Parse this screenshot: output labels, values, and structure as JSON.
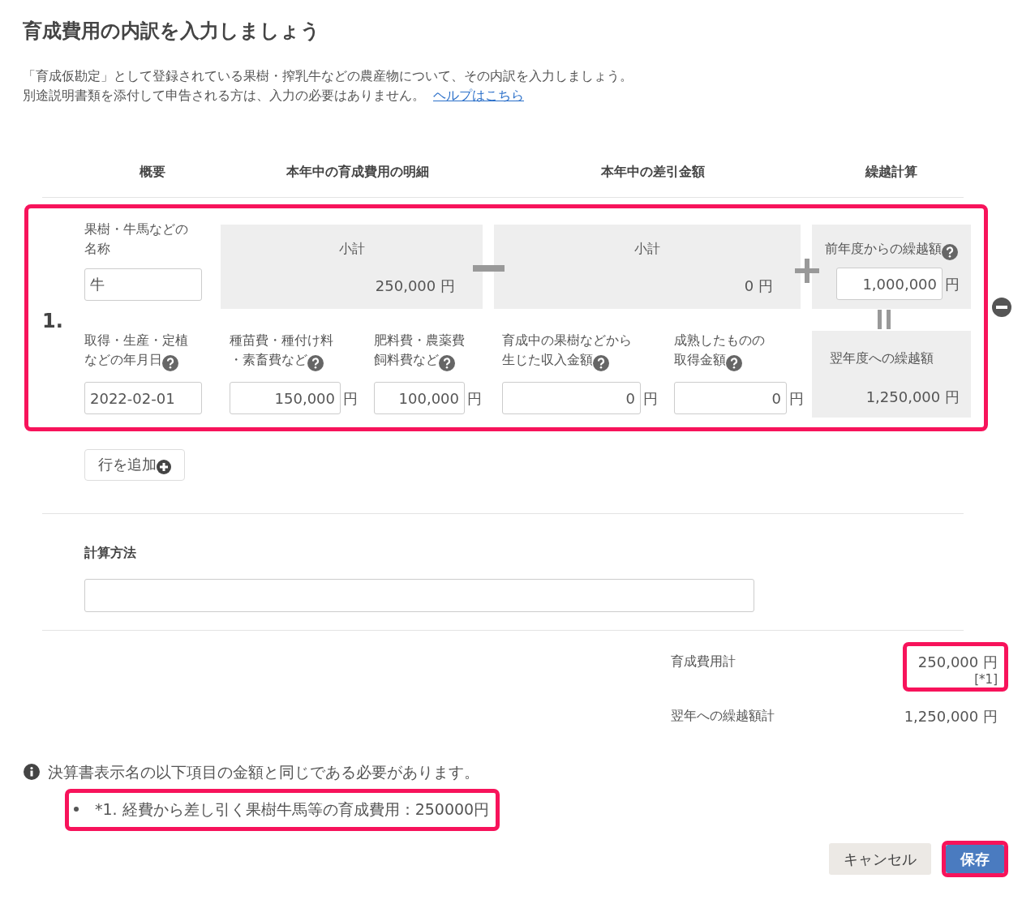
{
  "title": "育成費用の内訳を入力しましょう",
  "description": {
    "lines": [
      "「育成仮勘定」として登録されている果樹・搾乳牛などの農産物について、その内訳を入力しましょう。",
      "別途説明書類を添付して申告される方は、入力の必要はありません。"
    ],
    "help_link": "ヘルプはこちら"
  },
  "table": {
    "columns": [
      "概要",
      "本年中の育成費用の明細",
      "本年中の差引金額",
      "繰越計算"
    ],
    "rows": [
      {
        "number": "1.",
        "highlighted": true,
        "name_label": [
          "果樹・牛馬などの",
          "名称"
        ],
        "name_value": "牛",
        "date_label": [
          "取得・生産・定植",
          "などの年月日"
        ],
        "date_value": "2022-02-01",
        "cost_subtotal": {
          "label": "小計",
          "amount": "250,000",
          "unit": "円"
        },
        "costs": [
          {
            "label": [
              "種苗費・種付け料",
              "・素畜費など"
            ],
            "value": "150,000",
            "unit": "円"
          },
          {
            "label": [
              "肥料費・農薬費",
              "飼料費など"
            ],
            "value": "100,000",
            "unit": "円"
          }
        ],
        "deduction_subtotal": {
          "label": "小計",
          "amount": "0",
          "unit": "円"
        },
        "deductions": [
          {
            "label": [
              "育成中の果樹などから",
              "生じた収入金額"
            ],
            "value": "0",
            "unit": "円"
          },
          {
            "label": [
              "成熟したものの",
              "取得金額"
            ],
            "value": "0",
            "unit": "円"
          }
        ],
        "carryover_prev": {
          "label": "前年度からの繰越額",
          "value": "1,000,000",
          "unit": "円"
        },
        "carryover_next": {
          "label": "翌年度への繰越額",
          "amount": "1,250,000",
          "unit": "円"
        }
      }
    ]
  },
  "add_row_button": "行を追加",
  "calc_method": {
    "label": "計算方法"
  },
  "totals": [
    {
      "label": "育成費用計",
      "amount": "250,000",
      "unit": "円",
      "note": "[*1]",
      "highlighted": true
    },
    {
      "label": "翌年への繰越額計",
      "amount": "1,250,000",
      "unit": "円",
      "highlighted": false
    }
  ],
  "notice": {
    "text": "決算書表示名の以下項目の金額と同じである必要があります。",
    "items": [
      {
        "text": "*1. 経費から差し引く果樹牛馬等の育成費用：250000円",
        "highlighted": true
      }
    ]
  },
  "buttons": [
    {
      "label": "キャンセル",
      "kind": "secondary",
      "highlighted": false
    },
    {
      "label": "保存",
      "kind": "primary",
      "highlighted": true
    }
  ]
}
